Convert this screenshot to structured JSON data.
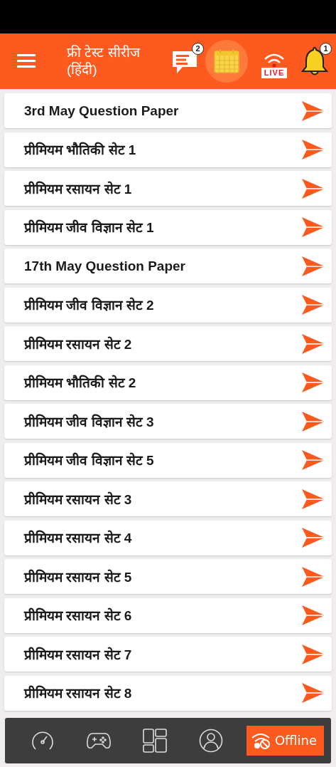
{
  "header": {
    "title_line1": "फ्री टेस्ट सीरीज",
    "title_line2": "(हिंदी)",
    "message_badge": "2",
    "live_label": "LIVE",
    "notification_badge": "1"
  },
  "papers": [
    {
      "title": "3rd May Question Paper"
    },
    {
      "title": "प्रीमियम भौतिकी सेट 1"
    },
    {
      "title": "प्रीमियम रसायन सेट 1"
    },
    {
      "title": "प्रीमियम जीव विज्ञान सेट 1"
    },
    {
      "title": "17th May Question Paper"
    },
    {
      "title": "प्रीमियम जीव विज्ञान सेट 2"
    },
    {
      "title": "प्रीमियम रसायन सेट 2"
    },
    {
      "title": "प्रीमियम भौतिकी सेट 2"
    },
    {
      "title": "प्रीमियम जीव विज्ञान सेट 3"
    },
    {
      "title": "प्रीमियम जीव विज्ञान सेट 5"
    },
    {
      "title": "प्रीमियम रसायन सेट 3"
    },
    {
      "title": "प्रीमियम रसायन सेट 4"
    },
    {
      "title": "प्रीमियम रसायन सेट 5"
    },
    {
      "title": "प्रीमियम रसायन सेट 6"
    },
    {
      "title": "प्रीमियम रसायन सेट 7"
    },
    {
      "title": "प्रीमियम रसायन सेट 8"
    }
  ],
  "bottom_nav": {
    "items": [
      {
        "kind": "speed"
      },
      {
        "kind": "games"
      },
      {
        "kind": "dashboard"
      },
      {
        "kind": "profile"
      }
    ],
    "status_label": "Offline"
  }
}
